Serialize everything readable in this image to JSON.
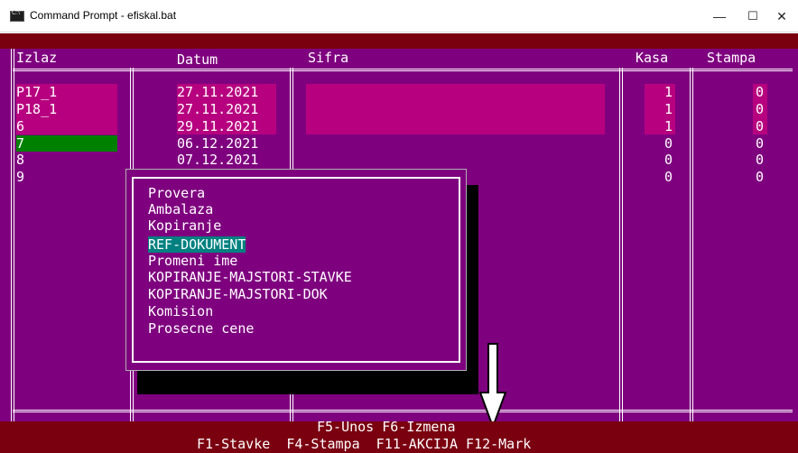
{
  "window": {
    "title": "Command Prompt - efiskal.bat",
    "minimize": "—",
    "maximize": "☐",
    "close": "✕"
  },
  "colors": {
    "console_bg": "#7f007f",
    "header_strip": "#7a0010",
    "selected_row": "#008000",
    "selected_menu": "#008080",
    "highlight": "#b7007f"
  },
  "table": {
    "headers": {
      "izlaz": "Izlaz",
      "datum": "Datum",
      "sifra": "Sifra",
      "kasa": "Kasa",
      "stampa": "Stampa"
    },
    "rows": [
      {
        "izlaz": "P17_1",
        "datum": "27.11.2021",
        "kasa": "1",
        "stampa": "0"
      },
      {
        "izlaz": "P18_1",
        "datum": "27.11.2021",
        "kasa": "1",
        "stampa": "0"
      },
      {
        "izlaz": "6",
        "datum": "29.11.2021",
        "kasa": "1",
        "stampa": "0"
      },
      {
        "izlaz": "7",
        "datum": "06.12.2021",
        "kasa": "0",
        "stampa": "0"
      },
      {
        "izlaz": "8",
        "datum": "07.12.2021",
        "kasa": "0",
        "stampa": "0"
      },
      {
        "izlaz": "9",
        "datum": "",
        "kasa": "0",
        "stampa": "0"
      }
    ]
  },
  "menu": {
    "items": [
      "Provera",
      "Ambalaza",
      "Kopiranje",
      "REF-DOKUMENT",
      "Promeni ime",
      "KOPIRANJE-MAJSTORI-STAVKE",
      "KOPIRANJE-MAJSTORI-DOK",
      "Komision",
      "Prosecne cene"
    ],
    "selected_index": 3
  },
  "footer": {
    "line1": "F5-Unos F6-Izmena",
    "line2": "F1-Stavke  F4-Stampa  F11-AKCIJA F12-Mark"
  }
}
